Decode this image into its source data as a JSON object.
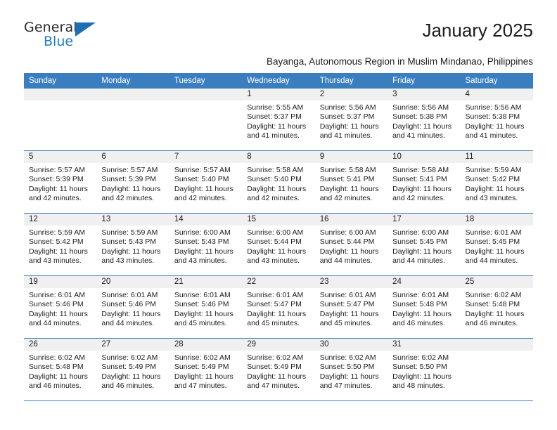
{
  "brand": {
    "name_top": "General",
    "name_bottom": "Blue",
    "triangle_color": "#1c6fb5",
    "blue_text_color": "#1f7ac4"
  },
  "header": {
    "title": "January 2025",
    "subtitle": "Bayanga, Autonomous Region in Muslim Mindanao, Philippines"
  },
  "theme": {
    "header_row_bg": "#3b7ec0",
    "header_row_text": "#ffffff",
    "daynum_band_bg": "#f0f0f0",
    "cell_bg": "#ffffff",
    "row_separator": "#3b7ec0"
  },
  "weekdays": [
    "Sunday",
    "Monday",
    "Tuesday",
    "Wednesday",
    "Thursday",
    "Friday",
    "Saturday"
  ],
  "weeks": [
    [
      {
        "day": "",
        "sunrise": "",
        "sunset": "",
        "daylight_line1": "",
        "daylight_line2": "",
        "empty": true
      },
      {
        "day": "",
        "sunrise": "",
        "sunset": "",
        "daylight_line1": "",
        "daylight_line2": "",
        "empty": true
      },
      {
        "day": "",
        "sunrise": "",
        "sunset": "",
        "daylight_line1": "",
        "daylight_line2": "",
        "empty": true
      },
      {
        "day": "1",
        "sunrise": "Sunrise: 5:55 AM",
        "sunset": "Sunset: 5:37 PM",
        "daylight_line1": "Daylight: 11 hours",
        "daylight_line2": "and 41 minutes.",
        "empty": false
      },
      {
        "day": "2",
        "sunrise": "Sunrise: 5:56 AM",
        "sunset": "Sunset: 5:37 PM",
        "daylight_line1": "Daylight: 11 hours",
        "daylight_line2": "and 41 minutes.",
        "empty": false
      },
      {
        "day": "3",
        "sunrise": "Sunrise: 5:56 AM",
        "sunset": "Sunset: 5:38 PM",
        "daylight_line1": "Daylight: 11 hours",
        "daylight_line2": "and 41 minutes.",
        "empty": false
      },
      {
        "day": "4",
        "sunrise": "Sunrise: 5:56 AM",
        "sunset": "Sunset: 5:38 PM",
        "daylight_line1": "Daylight: 11 hours",
        "daylight_line2": "and 41 minutes.",
        "empty": false
      }
    ],
    [
      {
        "day": "5",
        "sunrise": "Sunrise: 5:57 AM",
        "sunset": "Sunset: 5:39 PM",
        "daylight_line1": "Daylight: 11 hours",
        "daylight_line2": "and 42 minutes.",
        "empty": false
      },
      {
        "day": "6",
        "sunrise": "Sunrise: 5:57 AM",
        "sunset": "Sunset: 5:39 PM",
        "daylight_line1": "Daylight: 11 hours",
        "daylight_line2": "and 42 minutes.",
        "empty": false
      },
      {
        "day": "7",
        "sunrise": "Sunrise: 5:57 AM",
        "sunset": "Sunset: 5:40 PM",
        "daylight_line1": "Daylight: 11 hours",
        "daylight_line2": "and 42 minutes.",
        "empty": false
      },
      {
        "day": "8",
        "sunrise": "Sunrise: 5:58 AM",
        "sunset": "Sunset: 5:40 PM",
        "daylight_line1": "Daylight: 11 hours",
        "daylight_line2": "and 42 minutes.",
        "empty": false
      },
      {
        "day": "9",
        "sunrise": "Sunrise: 5:58 AM",
        "sunset": "Sunset: 5:41 PM",
        "daylight_line1": "Daylight: 11 hours",
        "daylight_line2": "and 42 minutes.",
        "empty": false
      },
      {
        "day": "10",
        "sunrise": "Sunrise: 5:58 AM",
        "sunset": "Sunset: 5:41 PM",
        "daylight_line1": "Daylight: 11 hours",
        "daylight_line2": "and 42 minutes.",
        "empty": false
      },
      {
        "day": "11",
        "sunrise": "Sunrise: 5:59 AM",
        "sunset": "Sunset: 5:42 PM",
        "daylight_line1": "Daylight: 11 hours",
        "daylight_line2": "and 43 minutes.",
        "empty": false
      }
    ],
    [
      {
        "day": "12",
        "sunrise": "Sunrise: 5:59 AM",
        "sunset": "Sunset: 5:42 PM",
        "daylight_line1": "Daylight: 11 hours",
        "daylight_line2": "and 43 minutes.",
        "empty": false
      },
      {
        "day": "13",
        "sunrise": "Sunrise: 5:59 AM",
        "sunset": "Sunset: 5:43 PM",
        "daylight_line1": "Daylight: 11 hours",
        "daylight_line2": "and 43 minutes.",
        "empty": false
      },
      {
        "day": "14",
        "sunrise": "Sunrise: 6:00 AM",
        "sunset": "Sunset: 5:43 PM",
        "daylight_line1": "Daylight: 11 hours",
        "daylight_line2": "and 43 minutes.",
        "empty": false
      },
      {
        "day": "15",
        "sunrise": "Sunrise: 6:00 AM",
        "sunset": "Sunset: 5:44 PM",
        "daylight_line1": "Daylight: 11 hours",
        "daylight_line2": "and 43 minutes.",
        "empty": false
      },
      {
        "day": "16",
        "sunrise": "Sunrise: 6:00 AM",
        "sunset": "Sunset: 5:44 PM",
        "daylight_line1": "Daylight: 11 hours",
        "daylight_line2": "and 44 minutes.",
        "empty": false
      },
      {
        "day": "17",
        "sunrise": "Sunrise: 6:00 AM",
        "sunset": "Sunset: 5:45 PM",
        "daylight_line1": "Daylight: 11 hours",
        "daylight_line2": "and 44 minutes.",
        "empty": false
      },
      {
        "day": "18",
        "sunrise": "Sunrise: 6:01 AM",
        "sunset": "Sunset: 5:45 PM",
        "daylight_line1": "Daylight: 11 hours",
        "daylight_line2": "and 44 minutes.",
        "empty": false
      }
    ],
    [
      {
        "day": "19",
        "sunrise": "Sunrise: 6:01 AM",
        "sunset": "Sunset: 5:46 PM",
        "daylight_line1": "Daylight: 11 hours",
        "daylight_line2": "and 44 minutes.",
        "empty": false
      },
      {
        "day": "20",
        "sunrise": "Sunrise: 6:01 AM",
        "sunset": "Sunset: 5:46 PM",
        "daylight_line1": "Daylight: 11 hours",
        "daylight_line2": "and 44 minutes.",
        "empty": false
      },
      {
        "day": "21",
        "sunrise": "Sunrise: 6:01 AM",
        "sunset": "Sunset: 5:46 PM",
        "daylight_line1": "Daylight: 11 hours",
        "daylight_line2": "and 45 minutes.",
        "empty": false
      },
      {
        "day": "22",
        "sunrise": "Sunrise: 6:01 AM",
        "sunset": "Sunset: 5:47 PM",
        "daylight_line1": "Daylight: 11 hours",
        "daylight_line2": "and 45 minutes.",
        "empty": false
      },
      {
        "day": "23",
        "sunrise": "Sunrise: 6:01 AM",
        "sunset": "Sunset: 5:47 PM",
        "daylight_line1": "Daylight: 11 hours",
        "daylight_line2": "and 45 minutes.",
        "empty": false
      },
      {
        "day": "24",
        "sunrise": "Sunrise: 6:01 AM",
        "sunset": "Sunset: 5:48 PM",
        "daylight_line1": "Daylight: 11 hours",
        "daylight_line2": "and 46 minutes.",
        "empty": false
      },
      {
        "day": "25",
        "sunrise": "Sunrise: 6:02 AM",
        "sunset": "Sunset: 5:48 PM",
        "daylight_line1": "Daylight: 11 hours",
        "daylight_line2": "and 46 minutes.",
        "empty": false
      }
    ],
    [
      {
        "day": "26",
        "sunrise": "Sunrise: 6:02 AM",
        "sunset": "Sunset: 5:48 PM",
        "daylight_line1": "Daylight: 11 hours",
        "daylight_line2": "and 46 minutes.",
        "empty": false
      },
      {
        "day": "27",
        "sunrise": "Sunrise: 6:02 AM",
        "sunset": "Sunset: 5:49 PM",
        "daylight_line1": "Daylight: 11 hours",
        "daylight_line2": "and 46 minutes.",
        "empty": false
      },
      {
        "day": "28",
        "sunrise": "Sunrise: 6:02 AM",
        "sunset": "Sunset: 5:49 PM",
        "daylight_line1": "Daylight: 11 hours",
        "daylight_line2": "and 47 minutes.",
        "empty": false
      },
      {
        "day": "29",
        "sunrise": "Sunrise: 6:02 AM",
        "sunset": "Sunset: 5:49 PM",
        "daylight_line1": "Daylight: 11 hours",
        "daylight_line2": "and 47 minutes.",
        "empty": false
      },
      {
        "day": "30",
        "sunrise": "Sunrise: 6:02 AM",
        "sunset": "Sunset: 5:50 PM",
        "daylight_line1": "Daylight: 11 hours",
        "daylight_line2": "and 47 minutes.",
        "empty": false
      },
      {
        "day": "31",
        "sunrise": "Sunrise: 6:02 AM",
        "sunset": "Sunset: 5:50 PM",
        "daylight_line1": "Daylight: 11 hours",
        "daylight_line2": "and 48 minutes.",
        "empty": false
      },
      {
        "day": "",
        "sunrise": "",
        "sunset": "",
        "daylight_line1": "",
        "daylight_line2": "",
        "empty": true
      }
    ]
  ]
}
